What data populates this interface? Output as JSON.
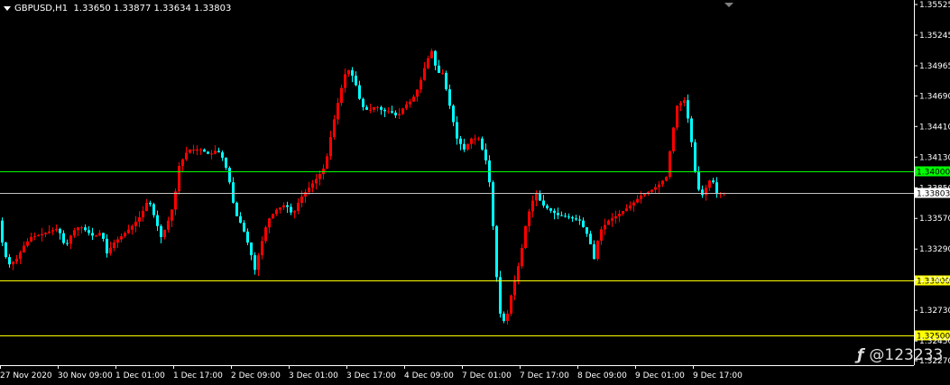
{
  "header": {
    "symbol_timeframe": "GBPUSD,H1",
    "ohlc": "1.33650 1.33877 1.33634 1.33803"
  },
  "watermark": "@123233",
  "colors": {
    "background": "#000000",
    "bull": "#ff0000",
    "bear": "#00ffff",
    "axis": "#ffffff",
    "line_green": "#00ff00",
    "line_yellow": "#ffff00",
    "line_grey": "#c0c0c0"
  },
  "chart_data": {
    "type": "candlestick",
    "ylim": [
      1.3227,
      1.3558
    ],
    "y_ticks": [
      "1.35525",
      "1.35245",
      "1.34965",
      "1.34690",
      "1.34410",
      "1.34130",
      "1.33850",
      "1.33570",
      "1.33290",
      "1.33010",
      "1.32730",
      "1.32450",
      "1.32270"
    ],
    "x_ticks": [
      "27 Nov 2020",
      "30 Nov 09:00",
      "1 Dec 01:00",
      "1 Dec 17:00",
      "2 Dec 09:00",
      "3 Dec 01:00",
      "3 Dec 17:00",
      "4 Dec 09:00",
      "7 Dec 01:00",
      "7 Dec 17:00",
      "8 Dec 09:00",
      "9 Dec 01:00",
      "9 Dec 17:00"
    ],
    "price_lines": [
      {
        "price": 1.34,
        "label": "1.34000",
        "color": "#00ff00"
      },
      {
        "price": 1.33803,
        "label": "1.33803",
        "color": "#c0c0c0"
      },
      {
        "price": 1.33,
        "label": "1.33000",
        "color": "#ffff00"
      },
      {
        "price": 1.325,
        "label": "1.32500",
        "color": "#ffff00"
      }
    ],
    "path": [
      [
        0,
        1.3355
      ],
      [
        6,
        1.3325
      ],
      [
        12,
        1.3315
      ],
      [
        20,
        1.332
      ],
      [
        28,
        1.3332
      ],
      [
        36,
        1.334
      ],
      [
        46,
        1.3342
      ],
      [
        56,
        1.3345
      ],
      [
        66,
        1.3348
      ],
      [
        74,
        1.333
      ],
      [
        82,
        1.3345
      ],
      [
        90,
        1.335
      ],
      [
        98,
        1.3345
      ],
      [
        106,
        1.334
      ],
      [
        114,
        1.3345
      ],
      [
        120,
        1.3325
      ],
      [
        128,
        1.3335
      ],
      [
        138,
        1.3342
      ],
      [
        148,
        1.335
      ],
      [
        158,
        1.336
      ],
      [
        166,
        1.3375
      ],
      [
        172,
        1.336
      ],
      [
        180,
        1.334
      ],
      [
        186,
        1.335
      ],
      [
        194,
        1.337
      ],
      [
        200,
        1.3405
      ],
      [
        210,
        1.342
      ],
      [
        224,
        1.342
      ],
      [
        234,
        1.3415
      ],
      [
        242,
        1.342
      ],
      [
        250,
        1.341
      ],
      [
        256,
        1.339
      ],
      [
        262,
        1.3362
      ],
      [
        270,
        1.335
      ],
      [
        278,
        1.333
      ],
      [
        284,
        1.331
      ],
      [
        290,
        1.333
      ],
      [
        298,
        1.3355
      ],
      [
        308,
        1.3365
      ],
      [
        318,
        1.337
      ],
      [
        326,
        1.336
      ],
      [
        334,
        1.3375
      ],
      [
        344,
        1.3385
      ],
      [
        354,
        1.3395
      ],
      [
        362,
        1.3405
      ],
      [
        370,
        1.344
      ],
      [
        378,
        1.347
      ],
      [
        386,
        1.3495
      ],
      [
        394,
        1.3485
      ],
      [
        402,
        1.346
      ],
      [
        410,
        1.3455
      ],
      [
        418,
        1.346
      ],
      [
        426,
        1.3455
      ],
      [
        434,
        1.3455
      ],
      [
        442,
        1.345
      ],
      [
        450,
        1.346
      ],
      [
        458,
        1.3465
      ],
      [
        466,
        1.3478
      ],
      [
        474,
        1.35
      ],
      [
        480,
        1.351
      ],
      [
        486,
        1.349
      ],
      [
        492,
        1.349
      ],
      [
        500,
        1.346
      ],
      [
        508,
        1.343
      ],
      [
        516,
        1.342
      ],
      [
        524,
        1.343
      ],
      [
        532,
        1.343
      ],
      [
        540,
        1.341
      ],
      [
        546,
        1.338
      ],
      [
        550,
        1.332
      ],
      [
        556,
        1.327
      ],
      [
        562,
        1.326
      ],
      [
        566,
        1.328
      ],
      [
        572,
        1.33
      ],
      [
        578,
        1.332
      ],
      [
        584,
        1.335
      ],
      [
        590,
        1.337
      ],
      [
        596,
        1.338
      ],
      [
        602,
        1.337
      ],
      [
        610,
        1.3365
      ],
      [
        620,
        1.336
      ],
      [
        632,
        1.3358
      ],
      [
        644,
        1.3355
      ],
      [
        654,
        1.334
      ],
      [
        660,
        1.332
      ],
      [
        666,
        1.3345
      ],
      [
        676,
        1.3355
      ],
      [
        686,
        1.336
      ],
      [
        694,
        1.3365
      ],
      [
        702,
        1.337
      ],
      [
        712,
        1.3378
      ],
      [
        722,
        1.3382
      ],
      [
        732,
        1.3388
      ],
      [
        740,
        1.3395
      ],
      [
        746,
        1.343
      ],
      [
        752,
        1.346
      ],
      [
        760,
        1.3465
      ],
      [
        766,
        1.344
      ],
      [
        772,
        1.34
      ],
      [
        778,
        1.3375
      ],
      [
        784,
        1.3385
      ],
      [
        790,
        1.3395
      ],
      [
        796,
        1.338
      ],
      [
        803,
        1.338
      ]
    ]
  }
}
